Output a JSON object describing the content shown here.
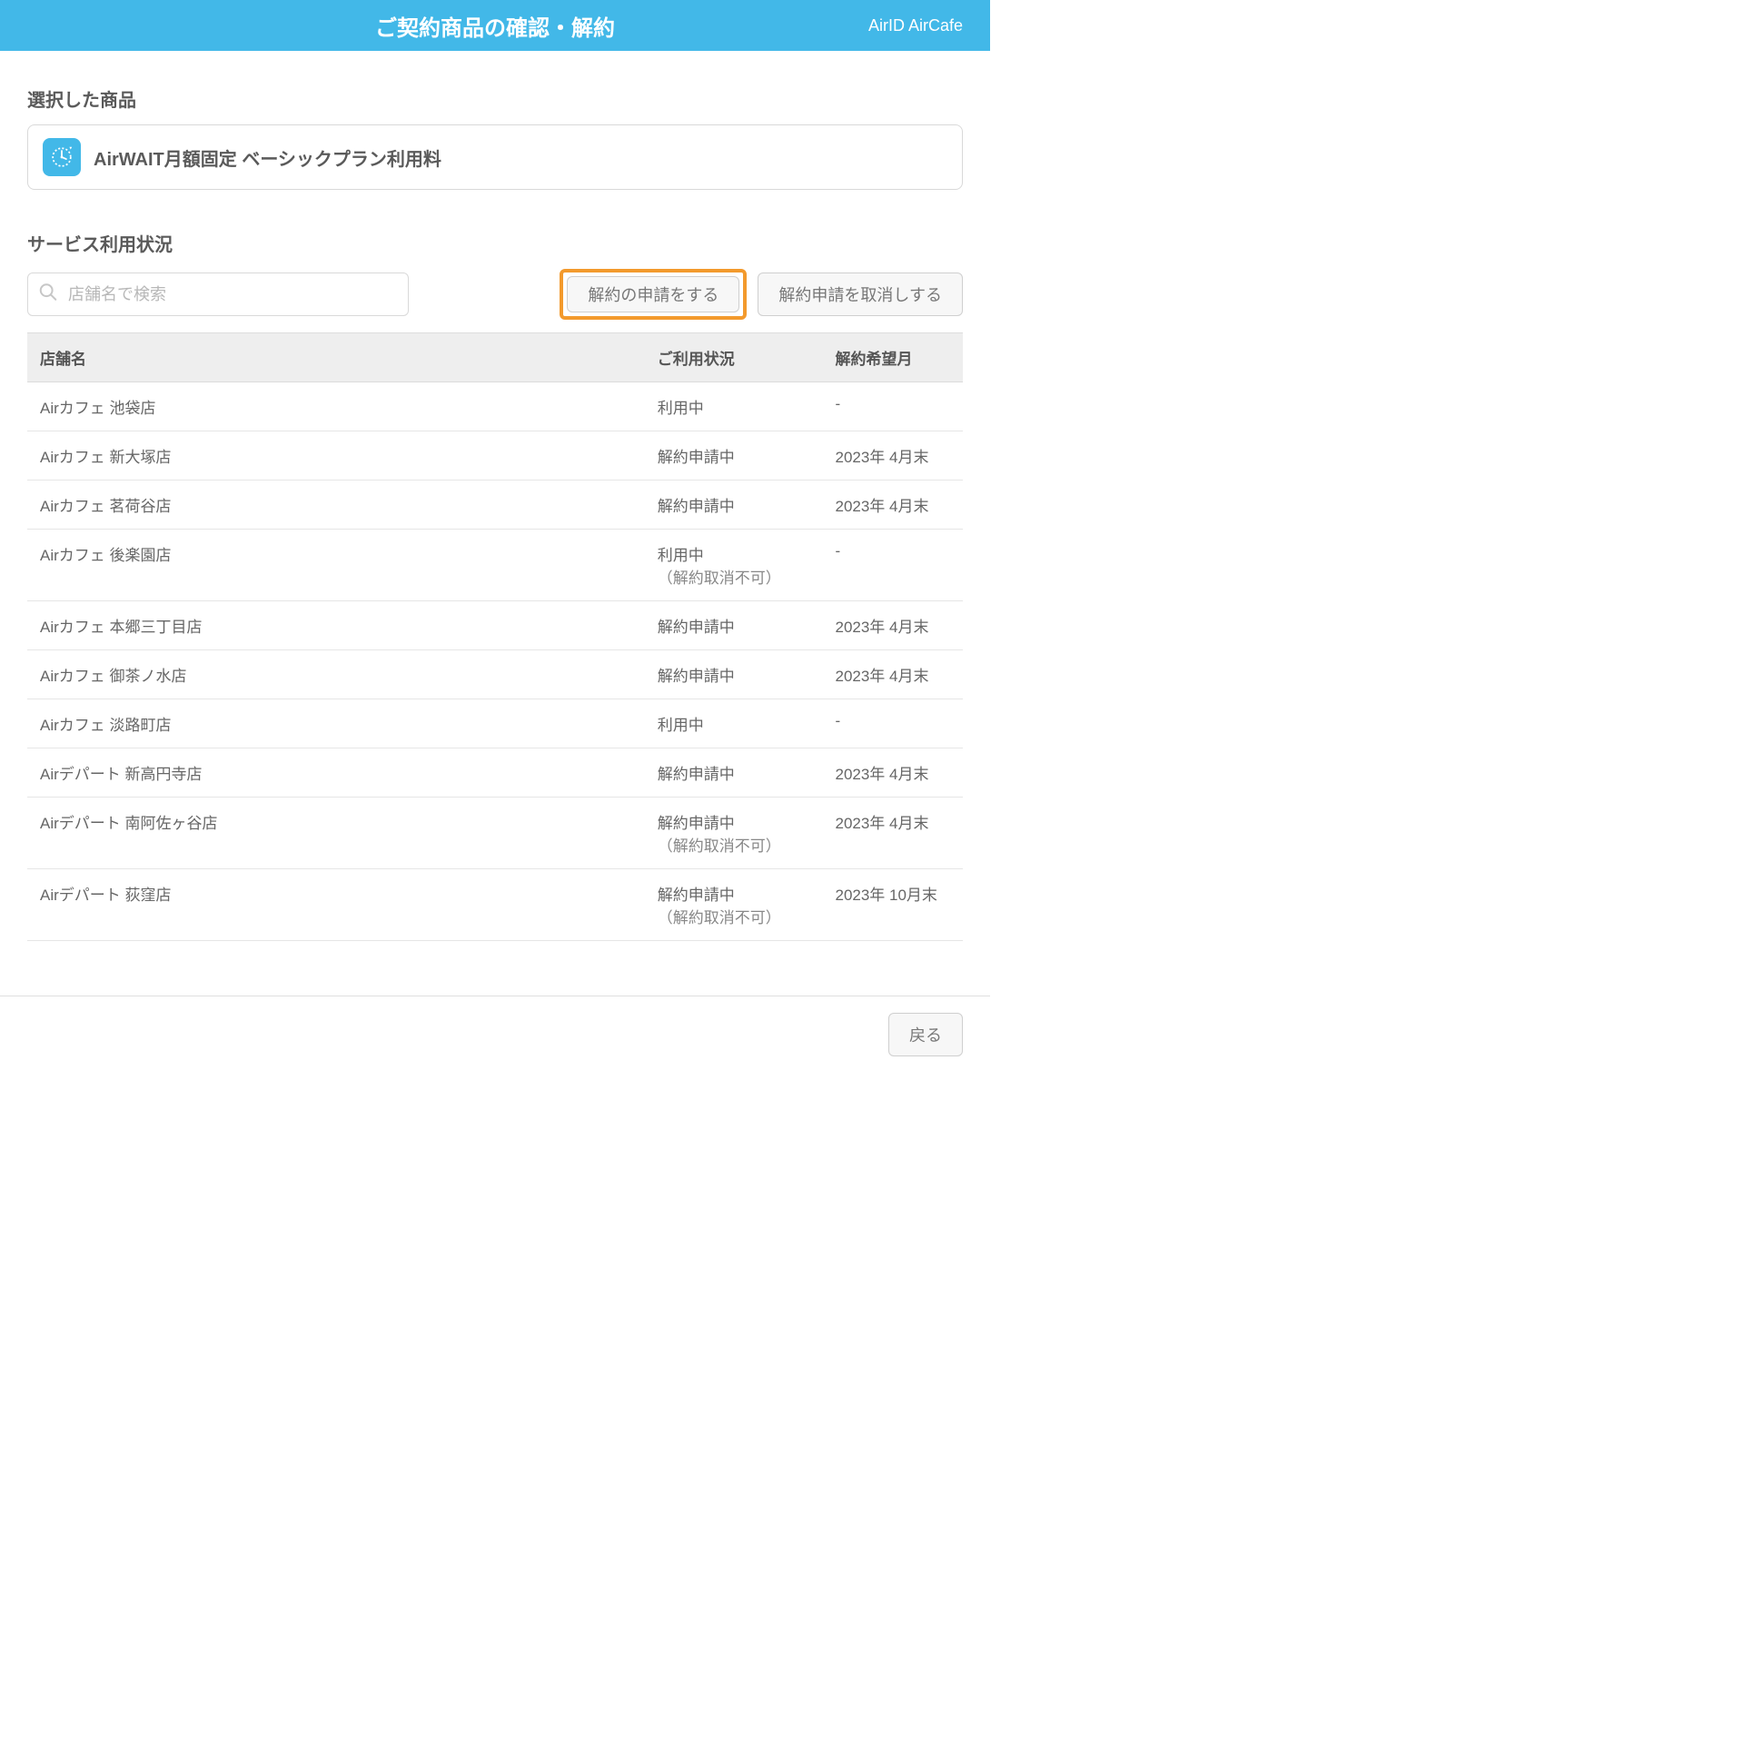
{
  "header": {
    "title": "ご契約商品の確認・解約",
    "account": "AirID AirCafe"
  },
  "sections": {
    "selected_product": "選択した商品",
    "service_usage": "サービス利用状況"
  },
  "product": {
    "name": "AirWAIT月額固定 ベーシックプラン利用料"
  },
  "search": {
    "placeholder": "店舗名で検索"
  },
  "actions": {
    "request_cancel": "解約の申請をする",
    "withdraw_cancel": "解約申請を取消しする"
  },
  "table": {
    "headers": {
      "store": "店舗名",
      "status": "ご利用状況",
      "date": "解約希望月"
    },
    "rows": [
      {
        "store": "Airカフェ 池袋店",
        "status": "利用中",
        "status_sub": "",
        "date": "-"
      },
      {
        "store": "Airカフェ 新大塚店",
        "status": "解約申請中",
        "status_sub": "",
        "date": "2023年 4月末"
      },
      {
        "store": "Airカフェ 茗荷谷店",
        "status": "解約申請中",
        "status_sub": "",
        "date": "2023年 4月末"
      },
      {
        "store": "Airカフェ 後楽園店",
        "status": "利用中",
        "status_sub": "（解約取消不可）",
        "date": "-"
      },
      {
        "store": "Airカフェ 本郷三丁目店",
        "status": "解約申請中",
        "status_sub": "",
        "date": "2023年 4月末"
      },
      {
        "store": "Airカフェ 御茶ノ水店",
        "status": "解約申請中",
        "status_sub": "",
        "date": "2023年 4月末"
      },
      {
        "store": "Airカフェ 淡路町店",
        "status": "利用中",
        "status_sub": "",
        "date": "-"
      },
      {
        "store": "Airデパート 新高円寺店",
        "status": "解約申請中",
        "status_sub": "",
        "date": "2023年 4月末"
      },
      {
        "store": "Airデパート 南阿佐ヶ谷店",
        "status": "解約申請中",
        "status_sub": "（解約取消不可）",
        "date": "2023年 4月末"
      },
      {
        "store": "Airデパート 荻窪店",
        "status": "解約申請中",
        "status_sub": "（解約取消不可）",
        "date": "2023年 10月末"
      }
    ]
  },
  "footer": {
    "back": "戻る"
  }
}
